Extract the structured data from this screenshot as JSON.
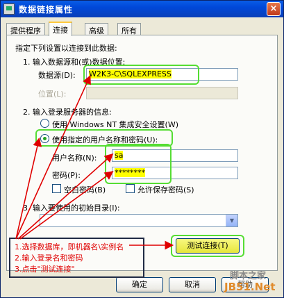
{
  "window": {
    "title": "数据链接属性",
    "close_glyph": "×"
  },
  "tabs": [
    {
      "label": "提供程序"
    },
    {
      "label": "连接"
    },
    {
      "label": "高级"
    },
    {
      "label": "所有"
    }
  ],
  "connection": {
    "intro": "指定下列设置以连接到此数据:",
    "step1": "1. 输入数据源和(或)数据位置:",
    "datasource_label": "数据源(D):",
    "datasource_value": "W2K3-C\\SQLEXPRESS",
    "location_label": "位置(L):",
    "step2": "2. 输入登录服务器的信息:",
    "radio_windows": "使用 Windows NT 集成安全设置(W)",
    "radio_specific": "使用指定的用户名称和密码(U):",
    "username_label": "用户名称(N):",
    "username_value": "sa",
    "password_label": "密码(P):",
    "password_value": "********",
    "blank_password": "空白密码(B)",
    "allow_save": "允许保存密码(S)",
    "step3": "3. 输入要使用的初始目录(I):",
    "test_button": "测试连接(T)"
  },
  "annotations": [
    "1.选择数据库，即机器名\\实例名",
    "2.输入登录名和密码",
    "3.点击\"测试连接\""
  ],
  "buttons": {
    "ok": "确定",
    "cancel": "取消",
    "help": "帮助"
  },
  "watermark": {
    "line1": "脚本之家",
    "line2": "JB51.Net"
  },
  "colors": {
    "annotation_red": "#E00000",
    "highlight_green": "#55DD33",
    "highlight_yellow": "#FFFF00"
  }
}
